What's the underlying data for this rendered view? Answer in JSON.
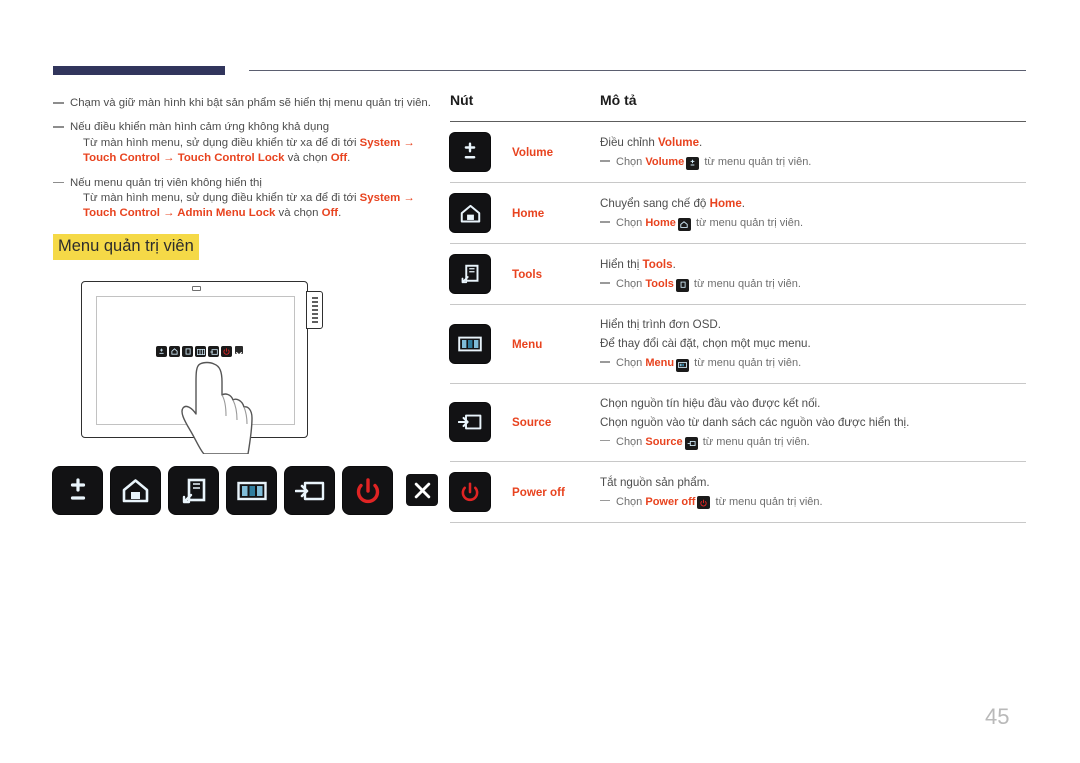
{
  "page": {
    "number": "45",
    "section_heading": "Menu quản trị viên"
  },
  "notes": [
    {
      "main": "Chạm và giữ màn hình khi bật sản phẩm sẽ hiển thị menu quản trị viên.",
      "sub": ""
    },
    {
      "main": "Nếu điều khiển màn hình cảm ứng không khả dụng",
      "sub_prefix": "Từ màn hình menu, sử dụng điều khiển từ xa để đi tới ",
      "sub_kw1": "System",
      "sub_arrow1": " → ",
      "sub_kw2": "Touch Control",
      "sub_arrow2": " → ",
      "sub_kw3": "Touch Control Lock",
      "sub_mid": " và chọn ",
      "sub_kw4": "Off",
      "sub_end": "."
    },
    {
      "main": "Nếu menu quản trị viên không hiển thị",
      "sub_prefix": "Từ màn hình menu, sử dụng điều khiển từ xa để đi tới ",
      "sub_kw1": "System",
      "sub_arrow1": " → ",
      "sub_kw2": "Touch Control",
      "sub_arrow2": " → ",
      "sub_kw3": "Admin Menu Lock",
      "sub_mid": " và chọn ",
      "sub_kw4": "Off",
      "sub_end": "."
    }
  ],
  "button_row": {
    "icons": [
      "volume-icon",
      "home-icon",
      "tools-icon",
      "menu-icon",
      "source-icon",
      "power-icon"
    ],
    "close_icon": "close-icon"
  },
  "table": {
    "headers": {
      "button": "Nút",
      "description": "Mô tả"
    },
    "rows": [
      {
        "icon": "volume-icon",
        "name": "Volume",
        "lines": [
          "Điều chỉnh "
        ],
        "line_kw": "Volume",
        "line_end": ".",
        "note_prefix": "Chọn ",
        "note_kw": "Volume",
        "note_suffix": " từ menu quản trị viên.",
        "note_icon": "volume-icon"
      },
      {
        "icon": "home-icon",
        "name": "Home",
        "lines": [
          "Chuyển sang chế độ "
        ],
        "line_kw": "Home",
        "line_end": ".",
        "note_prefix": "Chọn ",
        "note_kw": "Home",
        "note_suffix": " từ menu quản trị viên.",
        "note_icon": "home-icon"
      },
      {
        "icon": "tools-icon",
        "name": "Tools",
        "lines": [
          "Hiển thị "
        ],
        "line_kw": "Tools",
        "line_end": ".",
        "note_prefix": "Chọn ",
        "note_kw": "Tools",
        "note_suffix": " từ menu quản trị viên.",
        "note_icon": "tools-icon"
      },
      {
        "icon": "menu-icon",
        "name": "Menu",
        "lines": [
          "Hiển thị trình đơn OSD.",
          "Để thay đổi cài đặt, chọn một mục menu."
        ],
        "line_kw": "",
        "line_end": "",
        "note_prefix": "Chọn ",
        "note_kw": "Menu",
        "note_suffix": " từ menu quản trị viên.",
        "note_icon": "menu-icon"
      },
      {
        "icon": "source-icon",
        "name": "Source",
        "lines": [
          "Chọn nguồn tín hiệu đầu vào được kết nối.",
          "Chọn nguồn vào từ danh sách các nguồn vào được hiển thị."
        ],
        "line_kw": "",
        "line_end": "",
        "note_prefix": "Chọn ",
        "note_kw": "Source",
        "note_suffix": " từ menu quản trị viên.",
        "note_icon": "source-icon"
      },
      {
        "icon": "power-icon",
        "name": "Power off",
        "lines": [
          "Tắt nguồn sản phẩm."
        ],
        "line_kw": "",
        "line_end": "",
        "note_prefix": "Chọn ",
        "note_kw": "Power off",
        "note_suffix": " từ menu quản trị viên.",
        "note_icon": "power-icon"
      }
    ]
  },
  "colors": {
    "keyword": "#e8431f",
    "rule": "#31355c",
    "highlight": "#f5d947",
    "button_bg": "#121214",
    "power_red": "#e02424"
  }
}
